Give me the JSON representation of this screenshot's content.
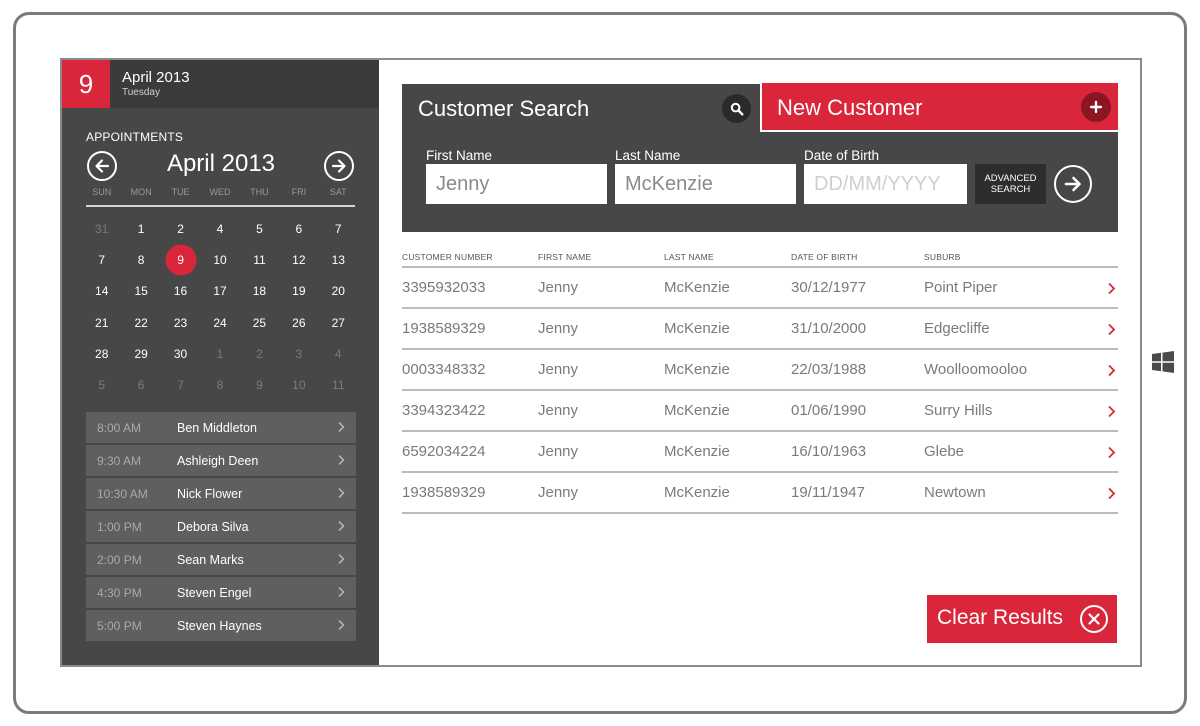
{
  "colors": {
    "accent": "#d9263a",
    "sidebar": "#474747",
    "panel": "#474747",
    "dark_button": "#2d2d2d"
  },
  "header": {
    "day": "9",
    "month_year": "April 2013",
    "weekday": "Tuesday"
  },
  "calendar": {
    "section_title": "APPOINTMENTS",
    "month_label": "April 2013",
    "weekdays": [
      "SUN",
      "MON",
      "TUE",
      "WED",
      "THU",
      "FRI",
      "SAT"
    ],
    "days": [
      {
        "n": "31",
        "other": true
      },
      {
        "n": "1"
      },
      {
        "n": "2"
      },
      {
        "n": "4"
      },
      {
        "n": "5"
      },
      {
        "n": "6"
      },
      {
        "n": "7"
      },
      {
        "n": "7"
      },
      {
        "n": "8"
      },
      {
        "n": "9",
        "today": true
      },
      {
        "n": "10"
      },
      {
        "n": "11"
      },
      {
        "n": "12"
      },
      {
        "n": "13"
      },
      {
        "n": "14"
      },
      {
        "n": "15"
      },
      {
        "n": "16"
      },
      {
        "n": "17"
      },
      {
        "n": "18"
      },
      {
        "n": "19"
      },
      {
        "n": "20"
      },
      {
        "n": "21"
      },
      {
        "n": "22"
      },
      {
        "n": "23"
      },
      {
        "n": "24"
      },
      {
        "n": "25"
      },
      {
        "n": "26"
      },
      {
        "n": "27"
      },
      {
        "n": "28"
      },
      {
        "n": "29"
      },
      {
        "n": "30"
      },
      {
        "n": "1",
        "other": true
      },
      {
        "n": "2",
        "other": true
      },
      {
        "n": "3",
        "other": true
      },
      {
        "n": "4",
        "other": true
      },
      {
        "n": "5",
        "other": true
      },
      {
        "n": "6",
        "other": true
      },
      {
        "n": "7",
        "other": true
      },
      {
        "n": "8",
        "other": true
      },
      {
        "n": "9",
        "other": true
      },
      {
        "n": "10",
        "other": true
      },
      {
        "n": "11",
        "other": true
      }
    ]
  },
  "appointments": [
    {
      "time": "8:00 AM",
      "name": "Ben Middleton"
    },
    {
      "time": "9:30 AM",
      "name": "Ashleigh Deen"
    },
    {
      "time": "10:30 AM",
      "name": "Nick Flower"
    },
    {
      "time": "1:00 PM",
      "name": "Debora Silva"
    },
    {
      "time": "2:00 PM",
      "name": "Sean Marks"
    },
    {
      "time": "4:30 PM",
      "name": "Steven Engel"
    },
    {
      "time": "5:00 PM",
      "name": "Steven Haynes"
    }
  ],
  "search": {
    "title": "Customer Search",
    "new_customer_label": "New Customer",
    "first_name_label": "First Name",
    "first_name_value": "Jenny",
    "last_name_label": "Last Name",
    "last_name_value": "McKenzie",
    "dob_label": "Date of Birth",
    "dob_placeholder": "DD/MM/YYYY",
    "advanced_line1": "ADVANCED",
    "advanced_line2": "SEARCH"
  },
  "table": {
    "headers": [
      "CUSTOMER NUMBER",
      "FIRST NAME",
      "LAST NAME",
      "DATE OF BIRTH",
      "SUBURB"
    ],
    "rows": [
      [
        "3395932033",
        "Jenny",
        "McKenzie",
        "30/12/1977",
        "Point Piper"
      ],
      [
        "1938589329",
        "Jenny",
        "McKenzie",
        "31/10/2000",
        "Edgecliffe"
      ],
      [
        "0003348332",
        "Jenny",
        "McKenzie",
        "22/03/1988",
        "Woolloomooloo"
      ],
      [
        "3394323422",
        "Jenny",
        "McKenzie",
        "01/06/1990",
        "Surry Hills"
      ],
      [
        "6592034224",
        "Jenny",
        "McKenzie",
        "16/10/1963",
        "Glebe"
      ],
      [
        "1938589329",
        "Jenny",
        "McKenzie",
        "19/11/1947",
        "Newtown"
      ]
    ]
  },
  "actions": {
    "clear_label": "Clear Results"
  }
}
